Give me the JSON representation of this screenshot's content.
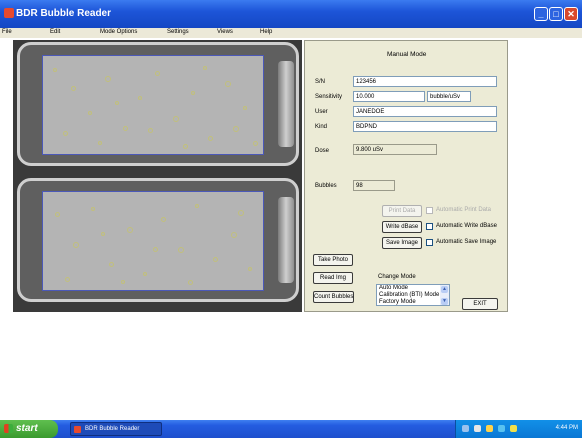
{
  "window": {
    "title": "BDR Bubble Reader"
  },
  "menu": [
    "File",
    "Edit",
    "Mode Options",
    "Settings",
    "Views",
    "Help"
  ],
  "panel": {
    "mode_title": "Manual Mode",
    "sn_label": "S/N",
    "sn_value": "123456",
    "sensitivity_label": "Sensitivity",
    "sensitivity_value": "10.000",
    "sensitivity_unit": "bubble/uSv",
    "user_label": "User",
    "user_value": "JANEDOE",
    "kind_label": "Kind",
    "kind_value": "BDPND",
    "dose_label": "Dose",
    "dose_value": "9.800   uSv",
    "bubbles_label": "Bubbles",
    "bubbles_value": "98",
    "print_data_label": "Print Data",
    "auto_print_label": "Automatic Print Data",
    "write_dbase_label": "Write dBase",
    "auto_write_label": "Automatic Write dBase",
    "save_image_label": "Save Image",
    "auto_save_label": "Automatic Save Image",
    "take_photo_label": "Take Photo",
    "read_img_label": "Read Img",
    "count_bubbles_label": "Count Bubbles",
    "change_mode_label": "Change Mode",
    "mode_options": [
      "Auto Mode",
      "Calibration (BTI) Mode",
      "Factory Mode"
    ],
    "exit_label": "EXIT"
  },
  "taskbar": {
    "start_label": "start",
    "task_label": "BDR Bubble Reader",
    "clock": "4:44 PM"
  },
  "colors": {
    "titlebar": "#1d55d8",
    "panel_bg": "#ecebd6",
    "start_green": "#3a9a2e"
  }
}
